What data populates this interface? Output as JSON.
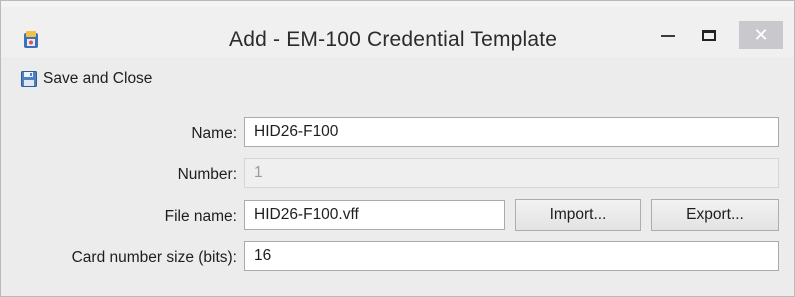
{
  "window": {
    "title": "Add - EM-100 Credential Template",
    "close_glyph": "✕"
  },
  "toolbar": {
    "save_close_label": "Save and Close",
    "save_icon": "floppy-disk-icon"
  },
  "form": {
    "name": {
      "label": "Name:",
      "value": "HID26-F100"
    },
    "number": {
      "label": "Number:",
      "value": "1"
    },
    "file_name": {
      "label": "File name:",
      "value": "HID26-F100.vff"
    },
    "card_number_size": {
      "label": "Card number size (bits):",
      "value": "16"
    }
  },
  "buttons": {
    "import_label": "Import...",
    "export_label": "Export..."
  },
  "colors": {
    "close_button_bg": "#c9c9cd",
    "window_bg": "#ececec",
    "field_border": "#aaaaaa"
  }
}
